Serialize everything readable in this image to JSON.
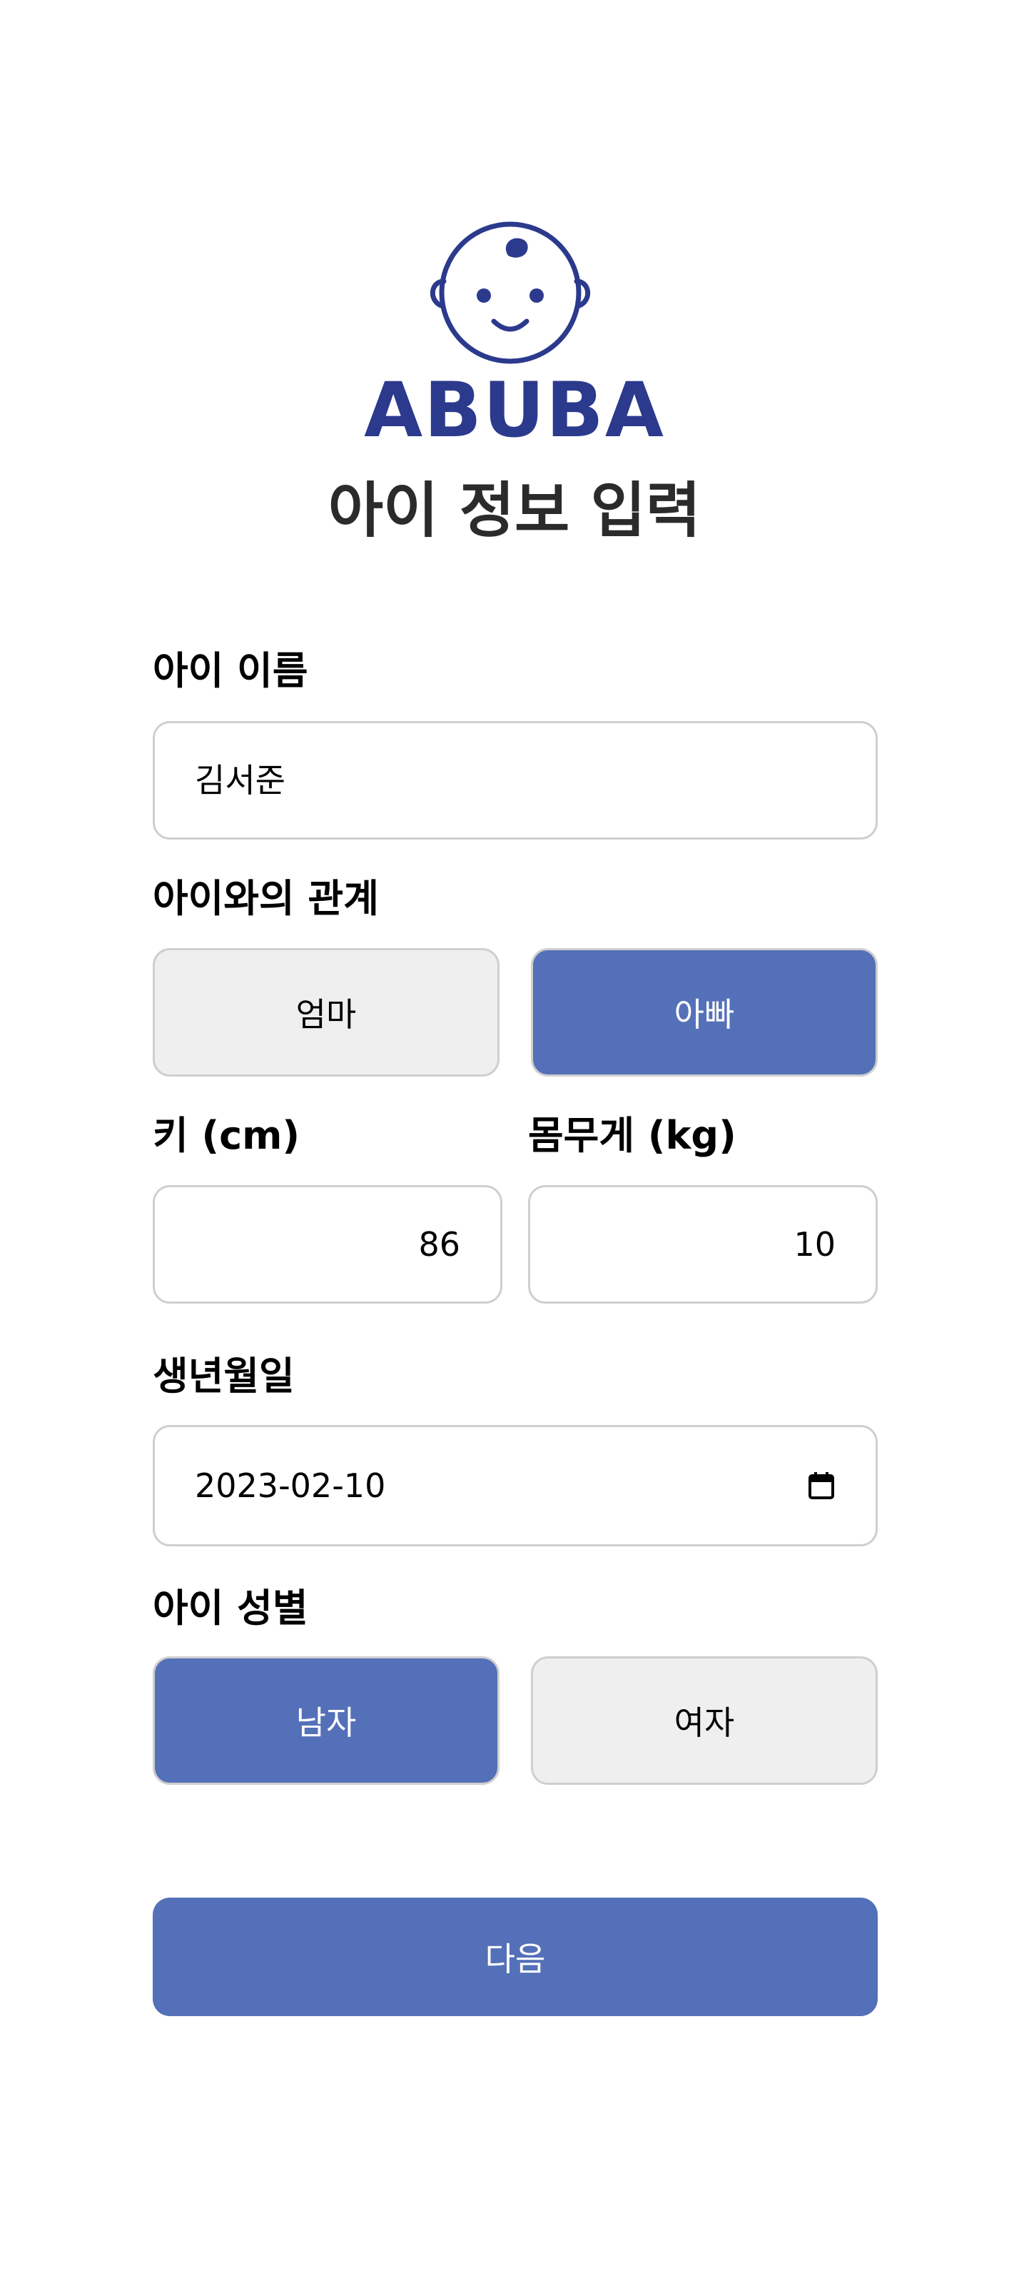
{
  "brand": {
    "name": "ABUBA",
    "logo_icon": "baby-face-icon",
    "color": "#2b3a8c"
  },
  "page_title": "아이 정보 입력",
  "form": {
    "child_name": {
      "label": "아이 이름",
      "value": "김서준"
    },
    "relationship": {
      "label": "아이와의 관계",
      "options": [
        "엄마",
        "아빠"
      ],
      "selected": "아빠"
    },
    "height": {
      "label": "키 (cm)",
      "value": "86"
    },
    "weight": {
      "label": "몸무게 (kg)",
      "value": "10"
    },
    "birthdate": {
      "label": "생년월일",
      "value": "2023-02-10",
      "icon": "calendar-icon"
    },
    "gender": {
      "label": "아이 성별",
      "options": [
        "남자",
        "여자"
      ],
      "selected": "남자"
    }
  },
  "next_button": {
    "label": "다음"
  },
  "colors": {
    "accent": "#5470b8",
    "unselected": "#efefef",
    "border": "#cfcfcf"
  }
}
